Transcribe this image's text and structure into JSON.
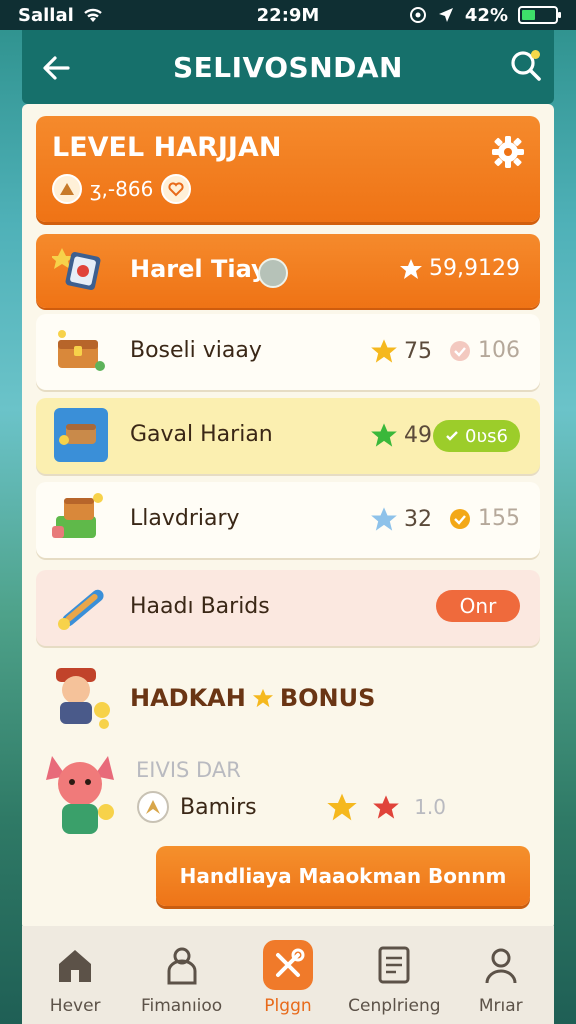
{
  "status": {
    "carrier": "Sallal",
    "time": "22:9M",
    "battery_pct": "42%",
    "battery_level": 0.42
  },
  "header": {
    "title": "SELIVOSNDAN"
  },
  "level": {
    "title": "LEVEL HARJJAN",
    "sub_value": "ʒ,-866"
  },
  "rows": [
    {
      "label": "Harel Tiay",
      "value": "59,9129",
      "featured": true
    },
    {
      "label": "Boseli viaay",
      "stars": "75",
      "secondary": "106",
      "star_color": "#f5b81e"
    },
    {
      "label": "Gaval Harian",
      "stars": "49",
      "pill": "0ʋs6",
      "star_color": "#3ab83a"
    },
    {
      "label": "Llavdriary",
      "stars": "32",
      "secondary": "155",
      "star_color": "#8ec2ea"
    },
    {
      "label": "Haadı Barids",
      "action": "Onr"
    }
  ],
  "bonus": {
    "title_left": "HADKAH",
    "title_right": "BONUS",
    "caption": "EIVIS DAR",
    "item_label": "Bamirs",
    "item_value": "1.0"
  },
  "cta": {
    "label": "Handliaya Maaokman Bonnm"
  },
  "nav": [
    {
      "label": "Hever",
      "icon": "home-icon",
      "active": false
    },
    {
      "label": "Fimanıioo",
      "icon": "person-bag-icon",
      "active": false
    },
    {
      "label": "Plggn",
      "icon": "tools-icon",
      "active": true
    },
    {
      "label": "Cenplrieng",
      "icon": "document-icon",
      "active": false
    },
    {
      "label": "Mrıar",
      "icon": "profile-icon",
      "active": false
    }
  ],
  "colors": {
    "accent": "#ef7315",
    "header": "#16706b",
    "panel": "#fbf7ea"
  }
}
